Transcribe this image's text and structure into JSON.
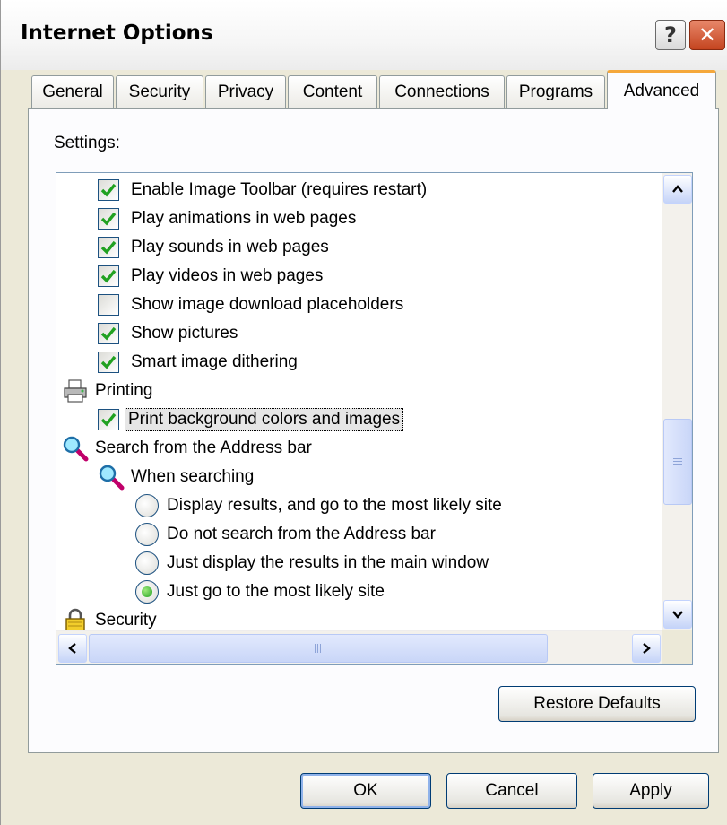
{
  "window": {
    "title": "Internet Options",
    "help_glyph": "?",
    "close_glyph": "✕"
  },
  "tabs": [
    {
      "label": "General"
    },
    {
      "label": "Security"
    },
    {
      "label": "Privacy"
    },
    {
      "label": "Content"
    },
    {
      "label": "Connections"
    },
    {
      "label": "Programs"
    },
    {
      "label": "Advanced",
      "active": true
    }
  ],
  "settings": {
    "label": "Settings:",
    "items": [
      {
        "type": "checkbox",
        "checked": true,
        "label": "Enable Image Toolbar (requires restart)"
      },
      {
        "type": "checkbox",
        "checked": true,
        "label": "Play animations in web pages"
      },
      {
        "type": "checkbox",
        "checked": true,
        "label": "Play sounds in web pages"
      },
      {
        "type": "checkbox",
        "checked": true,
        "label": "Play videos in web pages"
      },
      {
        "type": "checkbox",
        "checked": false,
        "label": "Show image download placeholders"
      },
      {
        "type": "checkbox",
        "checked": true,
        "label": "Show pictures"
      },
      {
        "type": "checkbox",
        "checked": true,
        "label": "Smart image dithering"
      },
      {
        "type": "category",
        "icon": "printer-icon",
        "label": "Printing"
      },
      {
        "type": "checkbox",
        "checked": true,
        "selected": true,
        "label": "Print background colors and images"
      },
      {
        "type": "category",
        "icon": "magnifier-icon",
        "label": "Search from the Address bar"
      },
      {
        "type": "category",
        "icon": "magnifier-icon",
        "label": "When searching"
      },
      {
        "type": "radio",
        "checked": false,
        "label": "Display results, and go to the most likely site"
      },
      {
        "type": "radio",
        "checked": false,
        "label": "Do not search from the Address bar"
      },
      {
        "type": "radio",
        "checked": false,
        "label": "Just display the results in the main window"
      },
      {
        "type": "radio",
        "checked": true,
        "label": "Just go to the most likely site"
      },
      {
        "type": "category",
        "icon": "lock-icon",
        "label": "Security"
      }
    ]
  },
  "buttons": {
    "restore_defaults": "Restore Defaults",
    "ok": "OK",
    "cancel": "Cancel",
    "apply": "Apply"
  },
  "colors": {
    "check": "#21a121",
    "active_tab_accent": "#f5a83b",
    "close_button": "#c4441f"
  }
}
